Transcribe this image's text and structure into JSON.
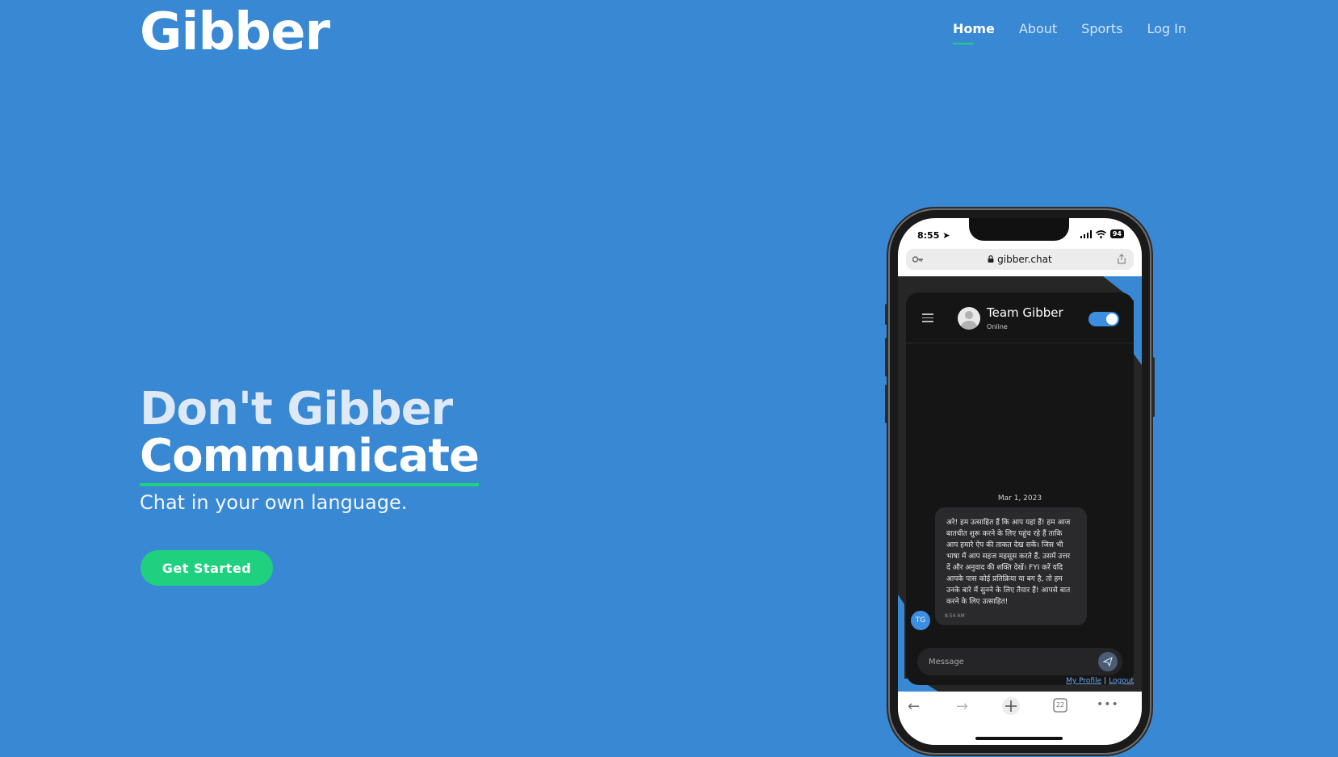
{
  "brand": {
    "logo": "Gibber"
  },
  "nav": {
    "items": [
      {
        "label": "Home",
        "active": true
      },
      {
        "label": "About",
        "active": false
      },
      {
        "label": "Sports",
        "active": false
      },
      {
        "label": "Log In",
        "active": false
      }
    ]
  },
  "hero": {
    "headline_line1": "Don't Gibber",
    "headline_line2": "Communicate",
    "tagline": "Chat in your own language.",
    "cta_label": "Get Started"
  },
  "colors": {
    "background": "#3988d3",
    "accent": "#1fd17f",
    "chat_dark": "#151515",
    "toggle_blue": "#3b8ee0"
  },
  "phone": {
    "status_time": "8:55",
    "battery": "94",
    "url": "gibber.chat",
    "chat": {
      "contact_name": "Team Gibber",
      "contact_status": "Online",
      "date": "Mar 1, 2023",
      "message": "अरे! हम उत्साहित हैं कि आप यहां हैं! हम आज बातचीत शुरू करने के लिए पहुंच रहे हैं ताकि आप हमारे ऐप की ताकत देख सकें। जिस भी भाषा में आप सहज महसूस करते हैं, उसमें उत्तर दें और अनुवाद की शक्ति देखें। FYI करें यदि आपके पास कोई प्रतिक्रिया या बग है, तो हम उनके बारे में सुनने के लिए तैयार हैं! आपसे बात करने के लिए उत्साहित!",
      "message_time": "8:54 AM",
      "sender_initials": "TG",
      "input_placeholder": "Message",
      "link_profile": "My Profile",
      "link_sep": "|",
      "link_logout": "Logout"
    },
    "browser_tabs_count": "22"
  },
  "icons": {
    "location": "location-arrow-icon",
    "signal": "cellular-signal-icon",
    "wifi": "wifi-icon",
    "key": "key-icon",
    "lock": "lock-icon",
    "share": "share-icon",
    "menu": "hamburger-menu-icon",
    "send": "send-icon",
    "back": "back-arrow-icon",
    "forward": "forward-arrow-icon",
    "new_tab": "plus-icon",
    "tabs": "tabs-icon",
    "more": "more-dots-icon"
  }
}
